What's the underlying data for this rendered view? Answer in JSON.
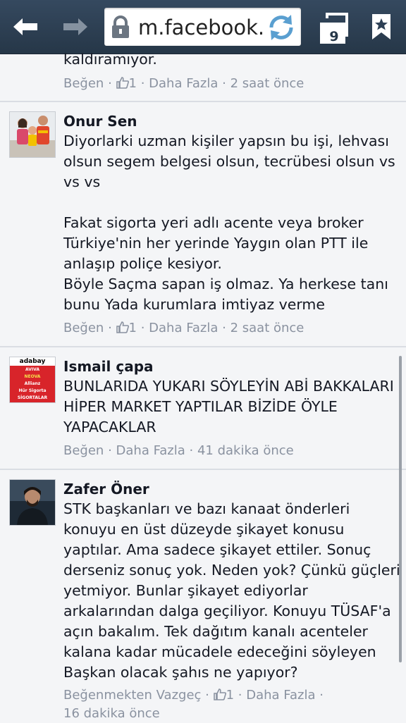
{
  "browser": {
    "url": "m.facebook.c",
    "tab_count": "9"
  },
  "comments": [
    {
      "text": "kaldıramıyor.",
      "like": "Beğen",
      "like_count": "1",
      "more": "Daha Fazla",
      "time": "2 saat önce"
    },
    {
      "author": "Onur Sen",
      "text": "Diyorlarki uzman kişiler yapsın bu işi, lehvası olsun segem belgesi olsun, tecrübesi olsun vs vs vs\n\nFakat sigorta yeri adlı acente veya broker Türkiye'nin her yerinde Yaygın olan PTT ile anlaşıp poliçe kesiyor.\nBöyle Saçma sapan iş olmaz. Ya herkese tanı bunu Yada kurumlara imtiyaz verme",
      "like": "Beğen",
      "like_count": "1",
      "more": "Daha Fazla",
      "time": "2 saat önce"
    },
    {
      "author": "Ismail çapa",
      "avatar_text": {
        "brand": "adabay",
        "lines": [
          "AVIVA",
          "NEOVA",
          "Allianz",
          "Hür Sigorta",
          "SİGORTALAR"
        ]
      },
      "text": "BUNLARIDA YUKARI SÖYLEYİN ABİ BAKKALARI HİPER MARKET YAPTILAR BİZİDE ÖYLE YAPACAKLAR",
      "like": "Beğen",
      "more": "Daha Fazla",
      "time": "41 dakika önce"
    },
    {
      "author": "Zafer Öner",
      "text": "STK başkanları ve bazı kanaat önderleri konuyu en üst düzeyde şikayet konusu yaptılar. Ama sadece şikayet ettiler. Sonuç derseniz sonuç yok. Neden yok? Çünkü güçleri yetmiyor. Bunlar şikayet ediyorlar arkalarından dalga geçiliyor. Konuyu TÜSAF'a açın bakalım. Tek dağıtım kanalı acenteler kalana kadar mücadele edeceğini söyleyen Başkan olacak şahıs ne yapıyor?",
      "unlike": "Beğenmekten Vazgeç",
      "like_count": "1",
      "more": "Daha Fazla",
      "time": "16 dakika önce"
    }
  ],
  "colors": {
    "toolbar": "#2d4055",
    "background": "#f4f5f7",
    "meta": "#8a92a0",
    "text": "#141823"
  }
}
